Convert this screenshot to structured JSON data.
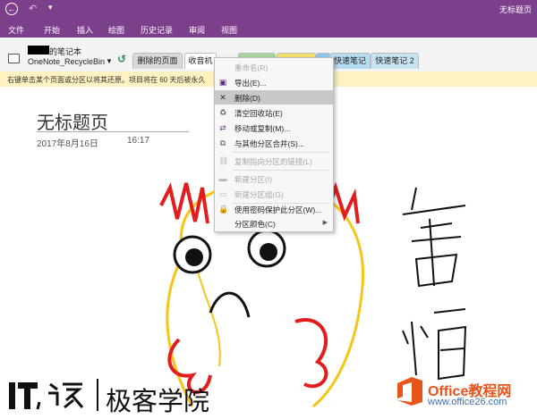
{
  "titlebar": {
    "window_title": "无标题页"
  },
  "ribbon": {
    "tabs": [
      "文件",
      "开始",
      "插入",
      "绘图",
      "历史记录",
      "审阅",
      "视图"
    ]
  },
  "notebook": {
    "name": "的笔记本",
    "section": "OneNote_RecycleBin"
  },
  "sections": [
    {
      "label": "删除的页面",
      "color": "#d9d9d9"
    },
    {
      "label": "收音机",
      "color": "#ffffff"
    },
    {
      "label": "",
      "color": "#a6d49a"
    },
    {
      "label": "",
      "color": "#f5e06b"
    },
    {
      "label": "",
      "color": "#8fc9e8"
    },
    {
      "label": "快速笔记",
      "color": "#b5dcf0"
    },
    {
      "label": "快速笔记 2",
      "color": "#c8e4f2"
    }
  ],
  "infobar": {
    "text": "右键单击某个页面或分区以将其还原。项目将在 60 天后被永久"
  },
  "page": {
    "title": "无标题页",
    "date": "2017年8月16日",
    "time": "16:17"
  },
  "context_menu": {
    "items": [
      {
        "label": "重命名(R)",
        "icon": "rename-icon",
        "glyph": "",
        "disabled": true,
        "highlighted": false,
        "submenu": false
      },
      {
        "label": "导出(E)...",
        "icon": "export-icon",
        "glyph": "▣",
        "disabled": false,
        "highlighted": false,
        "submenu": false
      },
      {
        "label": "删除(D)",
        "icon": "delete-icon",
        "glyph": "✕",
        "disabled": false,
        "highlighted": true,
        "submenu": false
      },
      {
        "label": "清空回收站(E)",
        "icon": "recycle-bin-icon",
        "glyph": "♻",
        "disabled": false,
        "highlighted": false,
        "submenu": false
      },
      {
        "label": "移动或复制(M)...",
        "icon": "move-copy-icon",
        "glyph": "⇄",
        "disabled": false,
        "highlighted": false,
        "submenu": false
      },
      {
        "label": "与其他分区合并(S)...",
        "icon": "merge-icon",
        "glyph": "⧉",
        "disabled": false,
        "highlighted": false,
        "submenu": false
      },
      {
        "label": "复制指向分区的链接(L)",
        "icon": "link-icon",
        "glyph": "⛓",
        "disabled": true,
        "highlighted": false,
        "submenu": false
      },
      {
        "label": "新建分区(I)",
        "icon": "new-section-icon",
        "glyph": "▬",
        "disabled": true,
        "highlighted": false,
        "submenu": false
      },
      {
        "label": "新建分区组(G)",
        "icon": "new-section-group-icon",
        "glyph": "▭",
        "disabled": true,
        "highlighted": false,
        "submenu": false
      },
      {
        "label": "使用密码保护此分区(W)...",
        "icon": "lock-icon",
        "glyph": "🔒",
        "disabled": false,
        "highlighted": false,
        "submenu": false
      },
      {
        "label": "分区颜色(C)",
        "icon": "",
        "glyph": "",
        "disabled": false,
        "highlighted": false,
        "submenu": true
      }
    ]
  },
  "watermarks": {
    "ithome_name": "极客学院",
    "office_name": "Office教程网",
    "office_url": "www.office26.com"
  }
}
